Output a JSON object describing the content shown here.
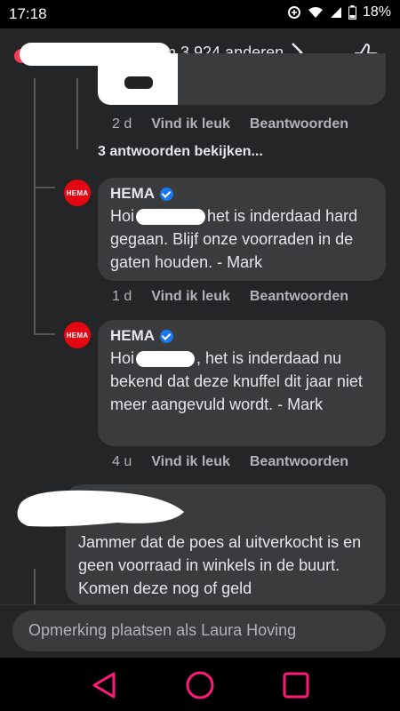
{
  "status_bar": {
    "time": "17:18",
    "battery": "18%"
  },
  "header": {
    "reaction_count_text": "n 3.924 anderen"
  },
  "previous_comment": {
    "time": "2 d",
    "like_label": "Vind ik leuk",
    "reply_label": "Beantwoorden",
    "view_replies": "3 antwoorden bekijken..."
  },
  "replies": [
    {
      "author": "HEMA",
      "avatar_text": "HEMA",
      "text_prefix": "Hoi",
      "text_main": "het is inderdaad hard gegaan. Blijf onze voorraden in de gaten houden. - Mark",
      "time": "1 d",
      "like_label": "Vind ik leuk",
      "reply_label": "Beantwoorden"
    },
    {
      "author": "HEMA",
      "avatar_text": "HEMA",
      "text_prefix": "Hoi",
      "text_main": ", het is inderdaad nu bekend dat deze knuffel dit jaar niet meer aangevuld wordt. - Mark",
      "time": "4 u",
      "like_label": "Vind ik leuk",
      "reply_label": "Beantwoorden"
    }
  ],
  "next_comment": {
    "text": "Jammer dat de poes al uitverkocht is en geen voorraad in winkels in de buurt. Komen deze nog of geld"
  },
  "composer": {
    "placeholder": "Opmerking plaatsen als Laura Hoving"
  },
  "colors": {
    "background": "#242526",
    "bubble": "#3a3b3c",
    "hema_red": "#e30613",
    "verified_blue": "#1877f2",
    "nav_pink": "#ff1a7a"
  }
}
